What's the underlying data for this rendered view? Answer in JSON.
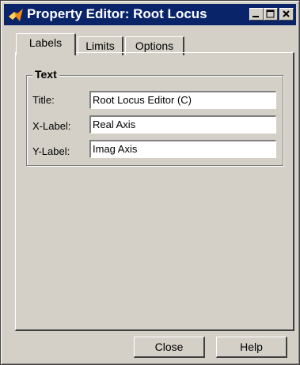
{
  "window": {
    "title": "Property Editor: Root Locus"
  },
  "tabs": [
    {
      "label": "Labels",
      "active": true
    },
    {
      "label": "Limits",
      "active": false
    },
    {
      "label": "Options",
      "active": false
    }
  ],
  "text_group": {
    "label": "Text",
    "fields": [
      {
        "label": "Title:",
        "value": "Root Locus Editor (C)"
      },
      {
        "label": "X-Label:",
        "value": "Real Axis"
      },
      {
        "label": "Y-Label:",
        "value": "Imag Axis"
      }
    ]
  },
  "buttons": {
    "close": "Close",
    "help": "Help"
  },
  "colors": {
    "titlebar": "#0a246a",
    "face": "#d4d0c8",
    "icon": "#f08a16"
  }
}
